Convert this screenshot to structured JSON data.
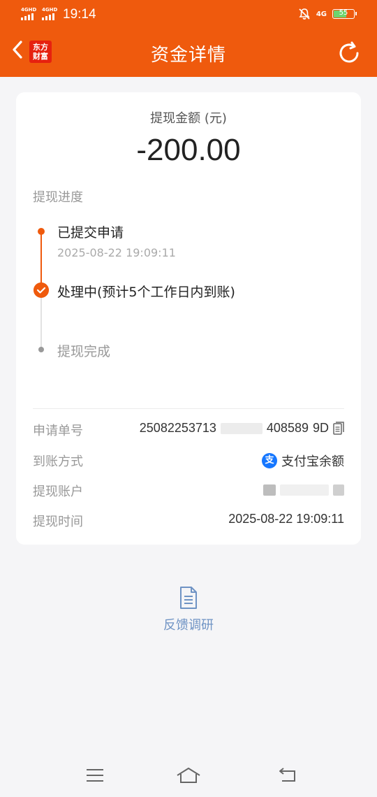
{
  "status_bar": {
    "signal_1": "4GHD",
    "signal_2": "4GHD",
    "time": "19:14",
    "network": "4G",
    "battery": "55"
  },
  "header": {
    "title": "资金详情",
    "logo_line1": "东方",
    "logo_line2": "财富",
    "icons": {
      "back": "back-arrow-icon",
      "refresh": "refresh-icon"
    }
  },
  "amount": {
    "label": "提现金额 (元)",
    "value": "-200.00"
  },
  "progress": {
    "label": "提现进度",
    "steps": [
      {
        "title": "已提交申请",
        "time": "2025-08-22 19:09:11",
        "state": "done"
      },
      {
        "title": "处理中(预计5个工作日内到账)",
        "state": "current"
      },
      {
        "title": "提现完成",
        "state": "pending"
      }
    ]
  },
  "details": {
    "order": {
      "label": "申请单号",
      "value_prefix": "25082253713",
      "value_suffix": "408589",
      "value_end": "9D"
    },
    "method": {
      "label": "到账方式",
      "value": "支付宝余额",
      "icon_glyph": "支"
    },
    "account": {
      "label": "提现账户"
    },
    "time": {
      "label": "提现时间",
      "value": "2025-08-22 19:09:11"
    }
  },
  "feedback": {
    "label": "反馈调研",
    "icon": "document-icon"
  },
  "colors": {
    "brand": "#ef5a0d",
    "link": "#6f93c4",
    "alipay": "#1677ff"
  }
}
